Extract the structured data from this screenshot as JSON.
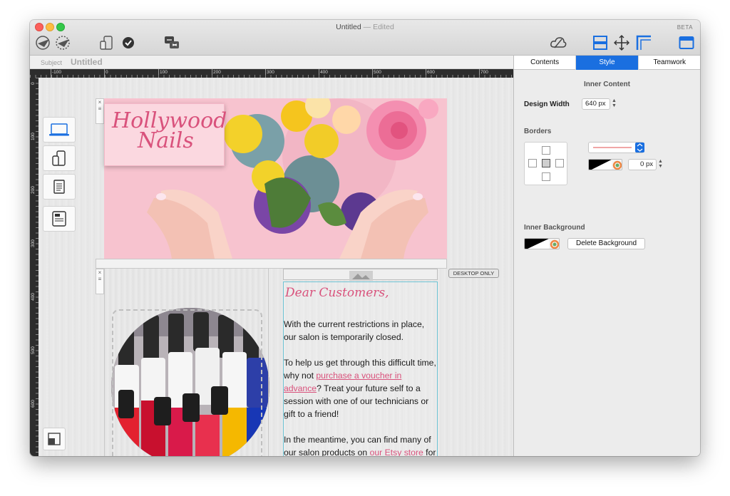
{
  "window": {
    "title": "Untitled",
    "title_suffix": "— Edited",
    "beta": "BETA"
  },
  "subject": {
    "label": "Subject",
    "value": "Untitled"
  },
  "rulers": {
    "top": [
      "-100",
      "0",
      "100",
      "200",
      "300",
      "400",
      "500",
      "600",
      "700"
    ],
    "left": [
      "0",
      "100",
      "200",
      "300",
      "400",
      "500",
      "600"
    ]
  },
  "hero": {
    "logo_line1": "Hollywood",
    "logo_line2": "Nails"
  },
  "canvas": {
    "desktop_badge": "DESKTOP ONLY"
  },
  "letter": {
    "greeting": "Dear Customers,",
    "p1": "With the current restrictions in place, our salon is temporarily closed.",
    "p2_before": "To help us get through this difficult time, why not ",
    "p2_link": "purchase a voucher in advance",
    "p2_after": "? Treat your future self to a session with one of our technicians or gift to a friend!",
    "p3_before": "In the meantime, you can find many of our salon products on ",
    "p3_link": "our Etsy store",
    "p3_after": " for a home pamper session!"
  },
  "inspector": {
    "tabs": [
      "Contents",
      "Style",
      "Teamwork"
    ],
    "active_tab": "Style",
    "inner_content_title": "Inner Content",
    "design_width_label": "Design Width",
    "design_width_value": "640 px",
    "borders_title": "Borders",
    "border_width_value": "0 px",
    "inner_background_title": "Inner Background",
    "delete_background_label": "Delete Background"
  },
  "icons": {
    "close": "×",
    "menu": "≡"
  },
  "colors": {
    "accent": "#1a6fe0",
    "brand_pink": "#d9527c",
    "column_outline": "#6dc3d4"
  }
}
